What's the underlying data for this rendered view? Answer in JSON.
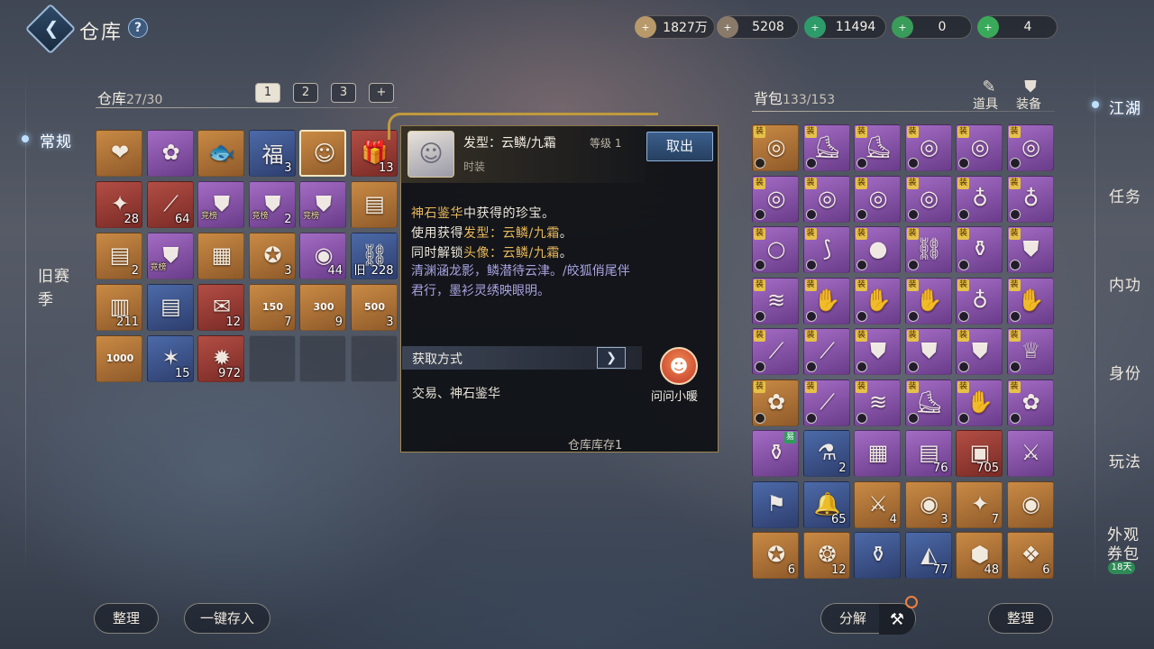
{
  "header": {
    "title": "仓库",
    "help_symbol": "?",
    "currencies": [
      {
        "icon": "scroll-coin-icon",
        "value": "1827万",
        "color": "#b89a6a"
      },
      {
        "icon": "copper-coin-icon",
        "value": "5208",
        "color": "#8a7a6a"
      },
      {
        "icon": "jade-coin-icon",
        "value": "11494",
        "color": "#2e9c6a"
      },
      {
        "icon": "jade-token-icon",
        "value": "0",
        "color": "#3a9c5a"
      },
      {
        "icon": "green-coin-icon",
        "value": "4",
        "color": "#3aaa5a"
      }
    ]
  },
  "storage": {
    "label": "仓库",
    "count": "27/30",
    "tabs": [
      "1",
      "2",
      "3",
      "+"
    ],
    "items": [
      {
        "icon": "heart-charm-icon",
        "quality": "gold",
        "count": "",
        "glyph": "❤"
      },
      {
        "icon": "pink-blossom-icon",
        "quality": "purple",
        "count": "",
        "glyph": "✿"
      },
      {
        "icon": "golden-fish-icon",
        "quality": "gold",
        "count": "",
        "glyph": "🐟"
      },
      {
        "icon": "fortune-card-icon",
        "quality": "blue",
        "count": "3",
        "glyph": "福"
      },
      {
        "icon": "white-hair-avatar-icon",
        "quality": "gold",
        "count": "",
        "glyph": "☺",
        "highlight": true
      },
      {
        "icon": "red-gift-box-icon",
        "quality": "red",
        "count": "13",
        "glyph": "🎁"
      },
      {
        "icon": "firecracker-icon",
        "quality": "red",
        "count": "28",
        "glyph": "✦"
      },
      {
        "icon": "red-scroll-icon",
        "quality": "red",
        "count": "64",
        "glyph": "⟋"
      },
      {
        "icon": "white-robe-icon",
        "quality": "purple",
        "count": "",
        "glyph": "⛊",
        "tag_text": "竞榜"
      },
      {
        "icon": "white-robe-icon",
        "quality": "purple",
        "count": "2",
        "glyph": "⛊",
        "tag_text": "竞榜"
      },
      {
        "icon": "white-robe-icon",
        "quality": "purple",
        "count": "",
        "glyph": "⛊",
        "tag_text": "竞榜"
      },
      {
        "icon": "dark-book-icon",
        "quality": "gold",
        "count": "",
        "glyph": "▤"
      },
      {
        "icon": "dark-book-icon",
        "quality": "gold",
        "count": "2",
        "glyph": "▤"
      },
      {
        "icon": "silver-armor-icon",
        "quality": "purple",
        "count": "",
        "glyph": "⛊",
        "tag_text": "竞榜"
      },
      {
        "icon": "ancient-map-icon",
        "quality": "gold",
        "count": "",
        "glyph": "▦"
      },
      {
        "icon": "gold-medal-icon",
        "quality": "gold",
        "count": "3",
        "glyph": "✪"
      },
      {
        "icon": "crystal-orb-icon",
        "quality": "purple",
        "count": "44",
        "glyph": "◉"
      },
      {
        "icon": "blue-chain-icon",
        "quality": "blue",
        "count": "228",
        "glyph": "⛓",
        "prefix": "旧"
      },
      {
        "icon": "blue-book-icon",
        "quality": "gold",
        "count": "211",
        "glyph": "▥"
      },
      {
        "icon": "navy-book-icon",
        "quality": "blue",
        "count": "",
        "glyph": "▤"
      },
      {
        "icon": "red-envelope-icon",
        "quality": "red",
        "count": "12",
        "glyph": "✉"
      },
      {
        "icon": "discount-coupon-150-icon",
        "quality": "gold",
        "count": "7",
        "glyph": "150"
      },
      {
        "icon": "discount-coupon-300-icon",
        "quality": "gold",
        "count": "9",
        "glyph": "300"
      },
      {
        "icon": "discount-coupon-500-icon",
        "quality": "gold",
        "count": "3",
        "glyph": "500"
      },
      {
        "icon": "discount-coupon-1000-icon",
        "quality": "gold",
        "count": "",
        "glyph": "1000"
      },
      {
        "icon": "blue-star-icon",
        "quality": "blue",
        "count": "15",
        "glyph": "✶"
      },
      {
        "icon": "red-firework-icon",
        "quality": "red",
        "count": "972",
        "glyph": "✹"
      },
      {
        "icon": "empty-slot",
        "quality": "empty",
        "count": "",
        "glyph": ""
      },
      {
        "icon": "empty-slot",
        "quality": "empty",
        "count": "",
        "glyph": ""
      },
      {
        "icon": "empty-slot",
        "quality": "empty",
        "count": "",
        "glyph": ""
      }
    ]
  },
  "tooltip": {
    "name": "发型：云鳞/九霜",
    "level": "等级 1",
    "type": "时装",
    "take_button": "取出",
    "line1_gold": "神石鉴华",
    "line1_rest": "中获得的珍宝。",
    "line2_pre": "使用获得",
    "line2_gold": "发型：云鳞/九霜",
    "line2_post": "。",
    "line3_pre": "同时解锁",
    "line3_gold": "头像：云鳞/九霜",
    "line3_post": "。",
    "lore": "清渊涵龙影，鳞潜待云津。/皎狐俏尾伴君行，墨衫灵绣映眼明。",
    "obtain_label": "获取方式",
    "obtain_value": "交易、神石鉴华",
    "stock": "仓库库存1",
    "helper_label": "问问小暖"
  },
  "bag": {
    "label": "背包",
    "count": "133/153",
    "tab_items": "道具",
    "tab_equip": "装备",
    "items": [
      {
        "icon": "sapphire-ring-icon",
        "quality": "gold",
        "count": "",
        "glyph": "◎",
        "tag": "装"
      },
      {
        "icon": "blue-boots-icon",
        "quality": "purple",
        "count": "",
        "glyph": "⛸",
        "tag": "装"
      },
      {
        "icon": "steel-boots-icon",
        "quality": "purple",
        "count": "",
        "glyph": "⛸",
        "tag": "装"
      },
      {
        "icon": "gold-ring-icon",
        "quality": "purple",
        "count": "",
        "glyph": "◎",
        "tag": "装"
      },
      {
        "icon": "silver-ring-icon",
        "quality": "purple",
        "count": "",
        "glyph": "◎",
        "tag": "装"
      },
      {
        "icon": "gem-ring-icon",
        "quality": "purple",
        "count": "",
        "glyph": "◎",
        "tag": "装"
      },
      {
        "icon": "emerald-ring-icon",
        "quality": "purple",
        "count": "",
        "glyph": "◎",
        "tag": "装"
      },
      {
        "icon": "bronze-ring-icon",
        "quality": "purple",
        "count": "",
        "glyph": "◎",
        "tag": "装"
      },
      {
        "icon": "blue-ring-icon",
        "quality": "purple",
        "count": "",
        "glyph": "◎",
        "tag": "装"
      },
      {
        "icon": "teal-ring-icon",
        "quality": "purple",
        "count": "",
        "glyph": "◎",
        "tag": "装"
      },
      {
        "icon": "beaded-necklace-icon",
        "quality": "purple",
        "count": "",
        "glyph": "♁",
        "tag": "装"
      },
      {
        "icon": "blue-necklace-icon",
        "quality": "purple",
        "count": "",
        "glyph": "♁",
        "tag": "装"
      },
      {
        "icon": "dark-bracelet-icon",
        "quality": "purple",
        "count": "",
        "glyph": "○",
        "tag": "装"
      },
      {
        "icon": "hairpin-icon",
        "quality": "purple",
        "count": "",
        "glyph": "⟆",
        "tag": "装"
      },
      {
        "icon": "bronze-medal-icon",
        "quality": "purple",
        "count": "",
        "glyph": "●",
        "tag": "装"
      },
      {
        "icon": "silver-chain-icon",
        "quality": "purple",
        "count": "",
        "glyph": "⛓",
        "tag": "装"
      },
      {
        "icon": "copper-pot-icon",
        "quality": "purple",
        "count": "",
        "glyph": "⚱",
        "tag": "装"
      },
      {
        "icon": "blue-armor-icon",
        "quality": "purple",
        "count": "",
        "glyph": "⛊",
        "tag": "装"
      },
      {
        "icon": "blue-belt-icon",
        "quality": "purple",
        "count": "",
        "glyph": "≋",
        "tag": "装"
      },
      {
        "icon": "blue-gauntlet-icon",
        "quality": "purple",
        "count": "",
        "glyph": "✋",
        "tag": "装"
      },
      {
        "icon": "red-gauntlet-icon",
        "quality": "purple",
        "count": "",
        "glyph": "✋",
        "tag": "装"
      },
      {
        "icon": "gold-gauntlet-icon",
        "quality": "purple",
        "count": "",
        "glyph": "✋",
        "tag": "装"
      },
      {
        "icon": "jade-necklace-icon",
        "quality": "purple",
        "count": "",
        "glyph": "♁",
        "tag": "装"
      },
      {
        "icon": "gold-bracer-icon",
        "quality": "purple",
        "count": "",
        "glyph": "✋",
        "tag": "装"
      },
      {
        "icon": "blue-bracer-icon",
        "quality": "purple",
        "count": "",
        "glyph": "⟋",
        "tag": "装"
      },
      {
        "icon": "steel-bracer-icon",
        "quality": "purple",
        "count": "",
        "glyph": "⟋",
        "tag": "装"
      },
      {
        "icon": "steel-armor-icon",
        "quality": "purple",
        "count": "",
        "glyph": "⛊",
        "tag": "装"
      },
      {
        "icon": "chain-armor-icon",
        "quality": "purple",
        "count": "",
        "glyph": "⛊",
        "tag": "装"
      },
      {
        "icon": "black-gold-armor-icon",
        "quality": "purple",
        "count": "",
        "glyph": "⛊",
        "tag": "装"
      },
      {
        "icon": "azure-dress-icon",
        "quality": "purple",
        "count": "",
        "glyph": "♕",
        "tag": "装"
      },
      {
        "icon": "rose-ring-icon",
        "quality": "gold",
        "count": "",
        "glyph": "✿",
        "tag": "装"
      },
      {
        "icon": "leather-bracer-icon",
        "quality": "purple",
        "count": "",
        "glyph": "⟋",
        "tag": "装"
      },
      {
        "icon": "red-belt-icon",
        "quality": "purple",
        "count": "",
        "glyph": "≋",
        "tag": "装"
      },
      {
        "icon": "red-greaves-icon",
        "quality": "purple",
        "count": "",
        "glyph": "⛸",
        "tag": "装"
      },
      {
        "icon": "crimson-glove-icon",
        "quality": "purple",
        "count": "",
        "glyph": "✋",
        "tag": "装"
      },
      {
        "icon": "red-flower-icon",
        "quality": "purple",
        "count": "",
        "glyph": "✿",
        "tag": "装"
      },
      {
        "icon": "porcelain-vase-icon",
        "quality": "purple",
        "count": "",
        "glyph": "⚱",
        "trade": "易"
      },
      {
        "icon": "potion-bottle-icon",
        "quality": "blue",
        "count": "2",
        "glyph": "⚗"
      },
      {
        "icon": "treasure-map-icon",
        "quality": "purple",
        "count": "",
        "glyph": "▦"
      },
      {
        "icon": "gold-scroll-icon",
        "quality": "purple",
        "count": "76",
        "glyph": "▤"
      },
      {
        "icon": "jade-stone-icon",
        "quality": "red",
        "count": "705",
        "glyph": "▣"
      },
      {
        "icon": "sword-pair-icon",
        "quality": "purple",
        "count": "",
        "glyph": "⚔"
      },
      {
        "icon": "blue-flag-icon",
        "quality": "blue",
        "count": "",
        "glyph": "⚑"
      },
      {
        "icon": "blue-bell-icon",
        "quality": "blue",
        "count": "65",
        "glyph": "🔔"
      },
      {
        "icon": "dagger-icon",
        "quality": "gold",
        "count": "4",
        "glyph": "⚔"
      },
      {
        "icon": "bronze-disc-icon",
        "quality": "gold",
        "count": "3",
        "glyph": "◉"
      },
      {
        "icon": "star-disc-icon",
        "quality": "gold",
        "count": "7",
        "glyph": "✦"
      },
      {
        "icon": "jade-disc-icon",
        "quality": "gold",
        "count": "",
        "glyph": "◉"
      },
      {
        "icon": "golden-compass-icon",
        "quality": "gold",
        "count": "6",
        "glyph": "✪"
      },
      {
        "icon": "phoenix-token-icon",
        "quality": "gold",
        "count": "12",
        "glyph": "❂"
      },
      {
        "icon": "celadon-vase-icon",
        "quality": "blue",
        "count": "",
        "glyph": "⚱"
      },
      {
        "icon": "blue-fan-icon",
        "quality": "blue",
        "count": "77",
        "glyph": "◭"
      },
      {
        "icon": "red-ore-icon",
        "quality": "gold",
        "count": "48",
        "glyph": "⬢"
      },
      {
        "icon": "gold-coin-icon",
        "quality": "gold",
        "count": "6",
        "glyph": "❖"
      }
    ]
  },
  "left_nav": {
    "regular": "常规",
    "old_season_line1": "旧赛",
    "old_season_line2": "季"
  },
  "right_nav": {
    "jianghu": "江湖",
    "task": "任务",
    "neigong": "内功",
    "identity": "身份",
    "gameplay": "玩法",
    "appearance_line1": "外观",
    "appearance_line2": "券包",
    "days_badge": "18天"
  },
  "bottom": {
    "sort_left": "整理",
    "deposit_all": "一键存入",
    "decompose": "分解",
    "sort_right": "整理"
  }
}
